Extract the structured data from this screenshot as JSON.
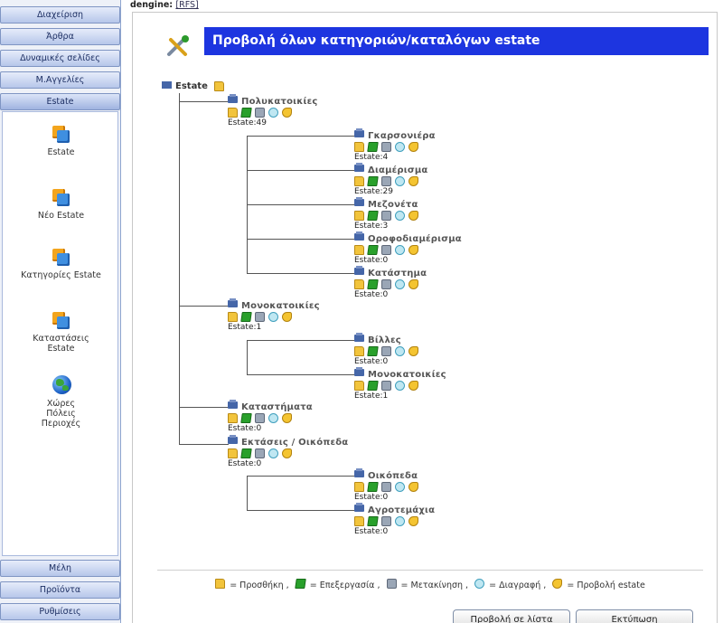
{
  "app": {
    "header_label": "dengine:",
    "header_link": "[RFS]"
  },
  "sidebar": {
    "top_menu": [
      "Διαχείριση",
      "Άρθρα",
      "Δυναμικές σελίδες",
      "Μ.Αγγελίες",
      "Estate"
    ],
    "items": [
      {
        "label": "Estate",
        "icon": "estate-cube-icon"
      },
      {
        "label": "Νέο Estate",
        "icon": "estate-cube-icon"
      },
      {
        "label": "Κατηγορίες Estate",
        "icon": "estate-cube-icon"
      },
      {
        "label": "Καταστάσεις Estate",
        "icon": "estate-cube-icon"
      },
      {
        "label": "Χώρες Πόλεις Περιοχές",
        "icon": "globe-icon"
      }
    ],
    "bottom_menu": [
      "Μέλη",
      "Προϊόντα",
      "Ρυθμίσεις"
    ]
  },
  "page": {
    "title": "Προβολή όλων κατηγοριών/καταλόγων estate"
  },
  "tree": {
    "root": "Estate",
    "nodes": [
      {
        "label": "Πολυκατοικίες",
        "count": "Estate:49"
      },
      {
        "label": "Γκαρσονιέρα",
        "count": "Estate:4"
      },
      {
        "label": "Διαμέρισμα",
        "count": "Estate:29"
      },
      {
        "label": "Μεζονέτα",
        "count": "Estate:3"
      },
      {
        "label": "Οροφοδιαμέρισμα",
        "count": "Estate:0"
      },
      {
        "label": "Κατάστημα",
        "count": "Estate:0"
      },
      {
        "label": "Μονοκατοικίες",
        "count": "Estate:1"
      },
      {
        "label": "Βίλλες",
        "count": "Estate:0"
      },
      {
        "label": "Μονοκατοικίες",
        "count": "Estate:1"
      },
      {
        "label": "Καταστήματα",
        "count": "Estate:0"
      },
      {
        "label": "Εκτάσεις / Οικόπεδα",
        "count": "Estate:0"
      },
      {
        "label": "Οικόπεδα",
        "count": "Estate:0"
      },
      {
        "label": "Αγροτεμάχια",
        "count": "Estate:0"
      }
    ]
  },
  "legend": {
    "add": "= Προσθήκη ,",
    "edit": "= Επεξεργασία ,",
    "move": "= Μετακίνηση ,",
    "delete": "= Διαγραφή ,",
    "view": "= Προβολή estate"
  },
  "buttons": {
    "list_view": "Προβολή σε λίστα",
    "print": "Εκτύπωση"
  }
}
